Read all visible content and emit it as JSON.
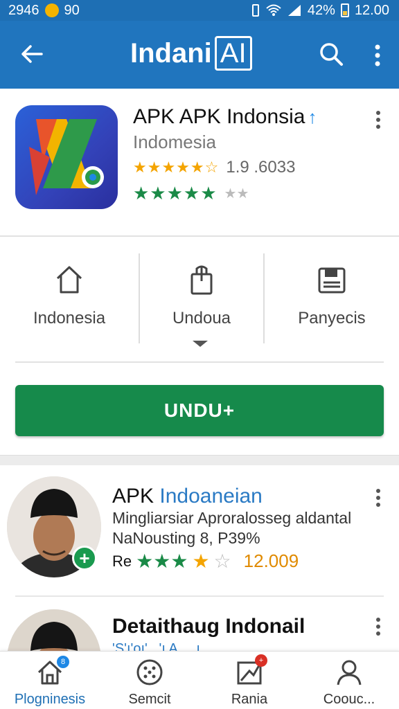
{
  "status_bar": {
    "left_text": "2946",
    "left_count": "90",
    "battery": "42%",
    "time": "12.00"
  },
  "app_bar": {
    "title_main": "Indani",
    "title_box": "AI"
  },
  "app": {
    "name": "APK APK Indonsia",
    "subtitle": "Indomesia",
    "rating_value": "1.9 .6033",
    "stars_primary": "★★★★★☆",
    "stars_secondary": "★★★★★",
    "stars_secondary_grey": "★★"
  },
  "categories": [
    {
      "label": "Indonesia",
      "icon": "home-icon"
    },
    {
      "label": "Undoua",
      "icon": "bag-icon"
    },
    {
      "label": "Panyecis",
      "icon": "save-icon"
    }
  ],
  "download_label": "UNDU+",
  "list": [
    {
      "title_plain": "APK ",
      "title_accent": "Indoaneian",
      "desc_line1": "Mingliarsiar Aproralosseg aldantal",
      "desc_line2": "NaNousting 8,  P39%",
      "rating_prefix": "Re",
      "rating_count": "12.009"
    },
    {
      "title_plain": "Detaithaug Indonail",
      "sub_fragment": "'S'ı'oı'_ 'ı A ... ı ..."
    }
  ],
  "bottom_nav": [
    {
      "label": "Plogninesis",
      "icon": "home-icon",
      "badge": "8"
    },
    {
      "label": "Semcit",
      "icon": "grid-dots-icon"
    },
    {
      "label": "Rania",
      "icon": "chart-icon",
      "badge": "+"
    },
    {
      "label": "Coouc...",
      "icon": "person-icon"
    }
  ],
  "colors": {
    "app_bar": "#2075be",
    "status_bar": "#1e6fb4",
    "download": "#168a4b",
    "accent_blue": "#2a7ac4",
    "rating_orange": "#e08a00"
  }
}
